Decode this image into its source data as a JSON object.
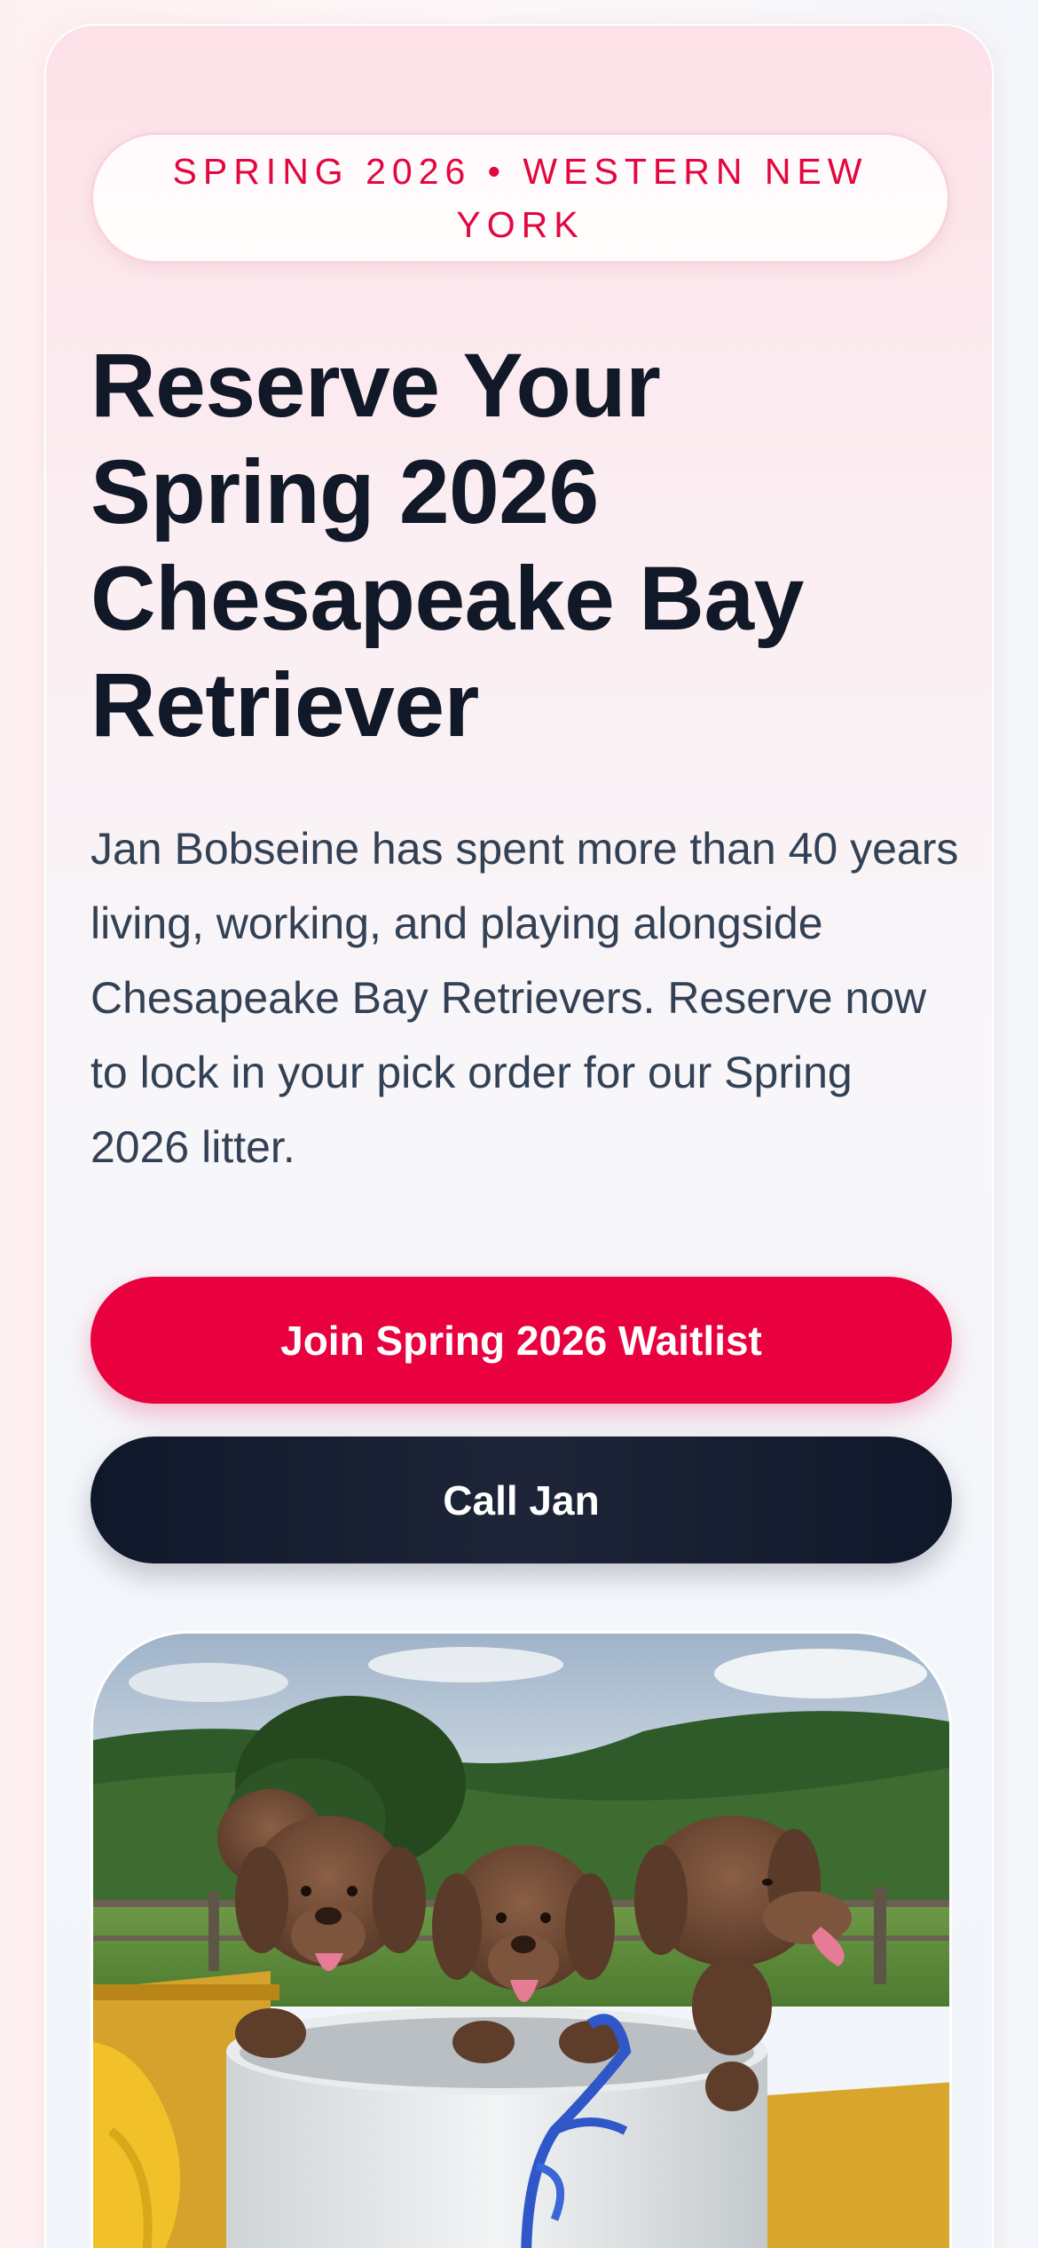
{
  "badge": {
    "label": "Spring 2026 • Western New York"
  },
  "hero": {
    "title": "Reserve Your Spring 2026 Chesapeake Bay Retriever",
    "intro": "Jan Bobseine has spent more than 40 years living, working, and playing alongside Chesapeake Bay Retrievers. Reserve now to lock in your pick order for our Spring 2026 litter."
  },
  "actions": {
    "primary_label": "Join Spring 2026 Waitlist",
    "secondary_label": "Call Jan"
  },
  "colors": {
    "accent": "#e8003f",
    "dark": "#111827",
    "body_text": "#334155"
  }
}
